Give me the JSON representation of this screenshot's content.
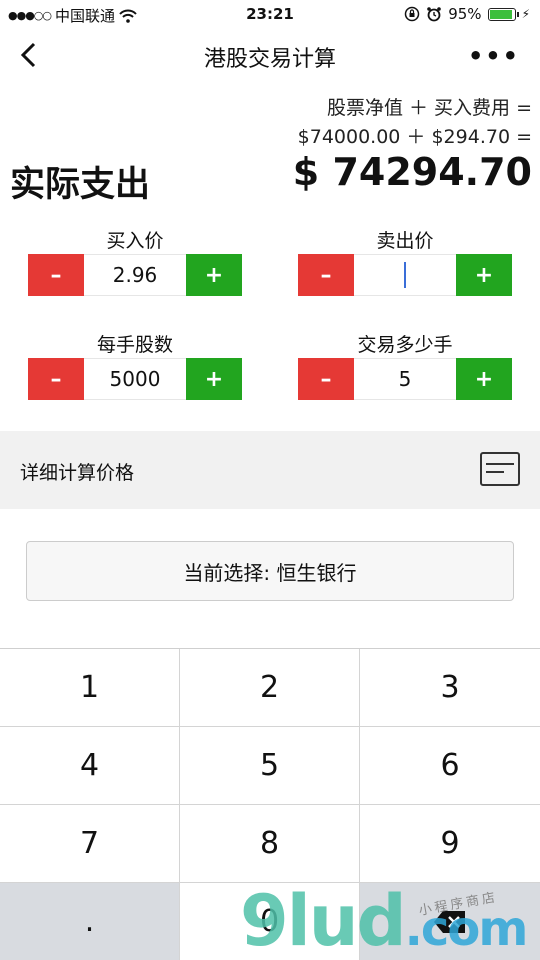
{
  "status_bar": {
    "signal": "●●●○○",
    "carrier": "中国联通",
    "wifi_icon": "wifi-icon",
    "time": "23:21",
    "battery_percent": "95%",
    "battery_level": 0.95
  },
  "nav": {
    "title": "港股交易计算",
    "back_icon": "chevron-left-icon",
    "more": "•••"
  },
  "summary": {
    "formula_line1": "股票净值 ＋ 买入费用 =",
    "formula_line2": "$74000.00 ＋ $294.70 =",
    "actual_label": "实际支出",
    "actual_amount": "$ 74294.70"
  },
  "inputs": {
    "buy_price": {
      "label": "买入价",
      "value": "2.96"
    },
    "sell_price": {
      "label": "卖出价",
      "value": ""
    },
    "lot_size": {
      "label": "每手股数",
      "value": "5000"
    },
    "lots": {
      "label": "交易多少手",
      "value": "5"
    },
    "minus_label": "–",
    "plus_label": "+"
  },
  "detail": {
    "label": "详细计算价格",
    "icon": "card-icon"
  },
  "selection": {
    "label": "当前选择: 恒生银行"
  },
  "keypad": {
    "keys": [
      "1",
      "2",
      "3",
      "4",
      "5",
      "6",
      "7",
      "8",
      "9",
      ".",
      "0",
      ""
    ],
    "delete_icon": "backspace-icon"
  },
  "colors": {
    "minus": "#e53935",
    "plus": "#22a51f",
    "caret": "#3a6ed8",
    "keypad_grey": "#d8dbe0"
  },
  "watermark": {
    "main": "9lud",
    "suffix": ".com",
    "small": "小程序商店"
  }
}
